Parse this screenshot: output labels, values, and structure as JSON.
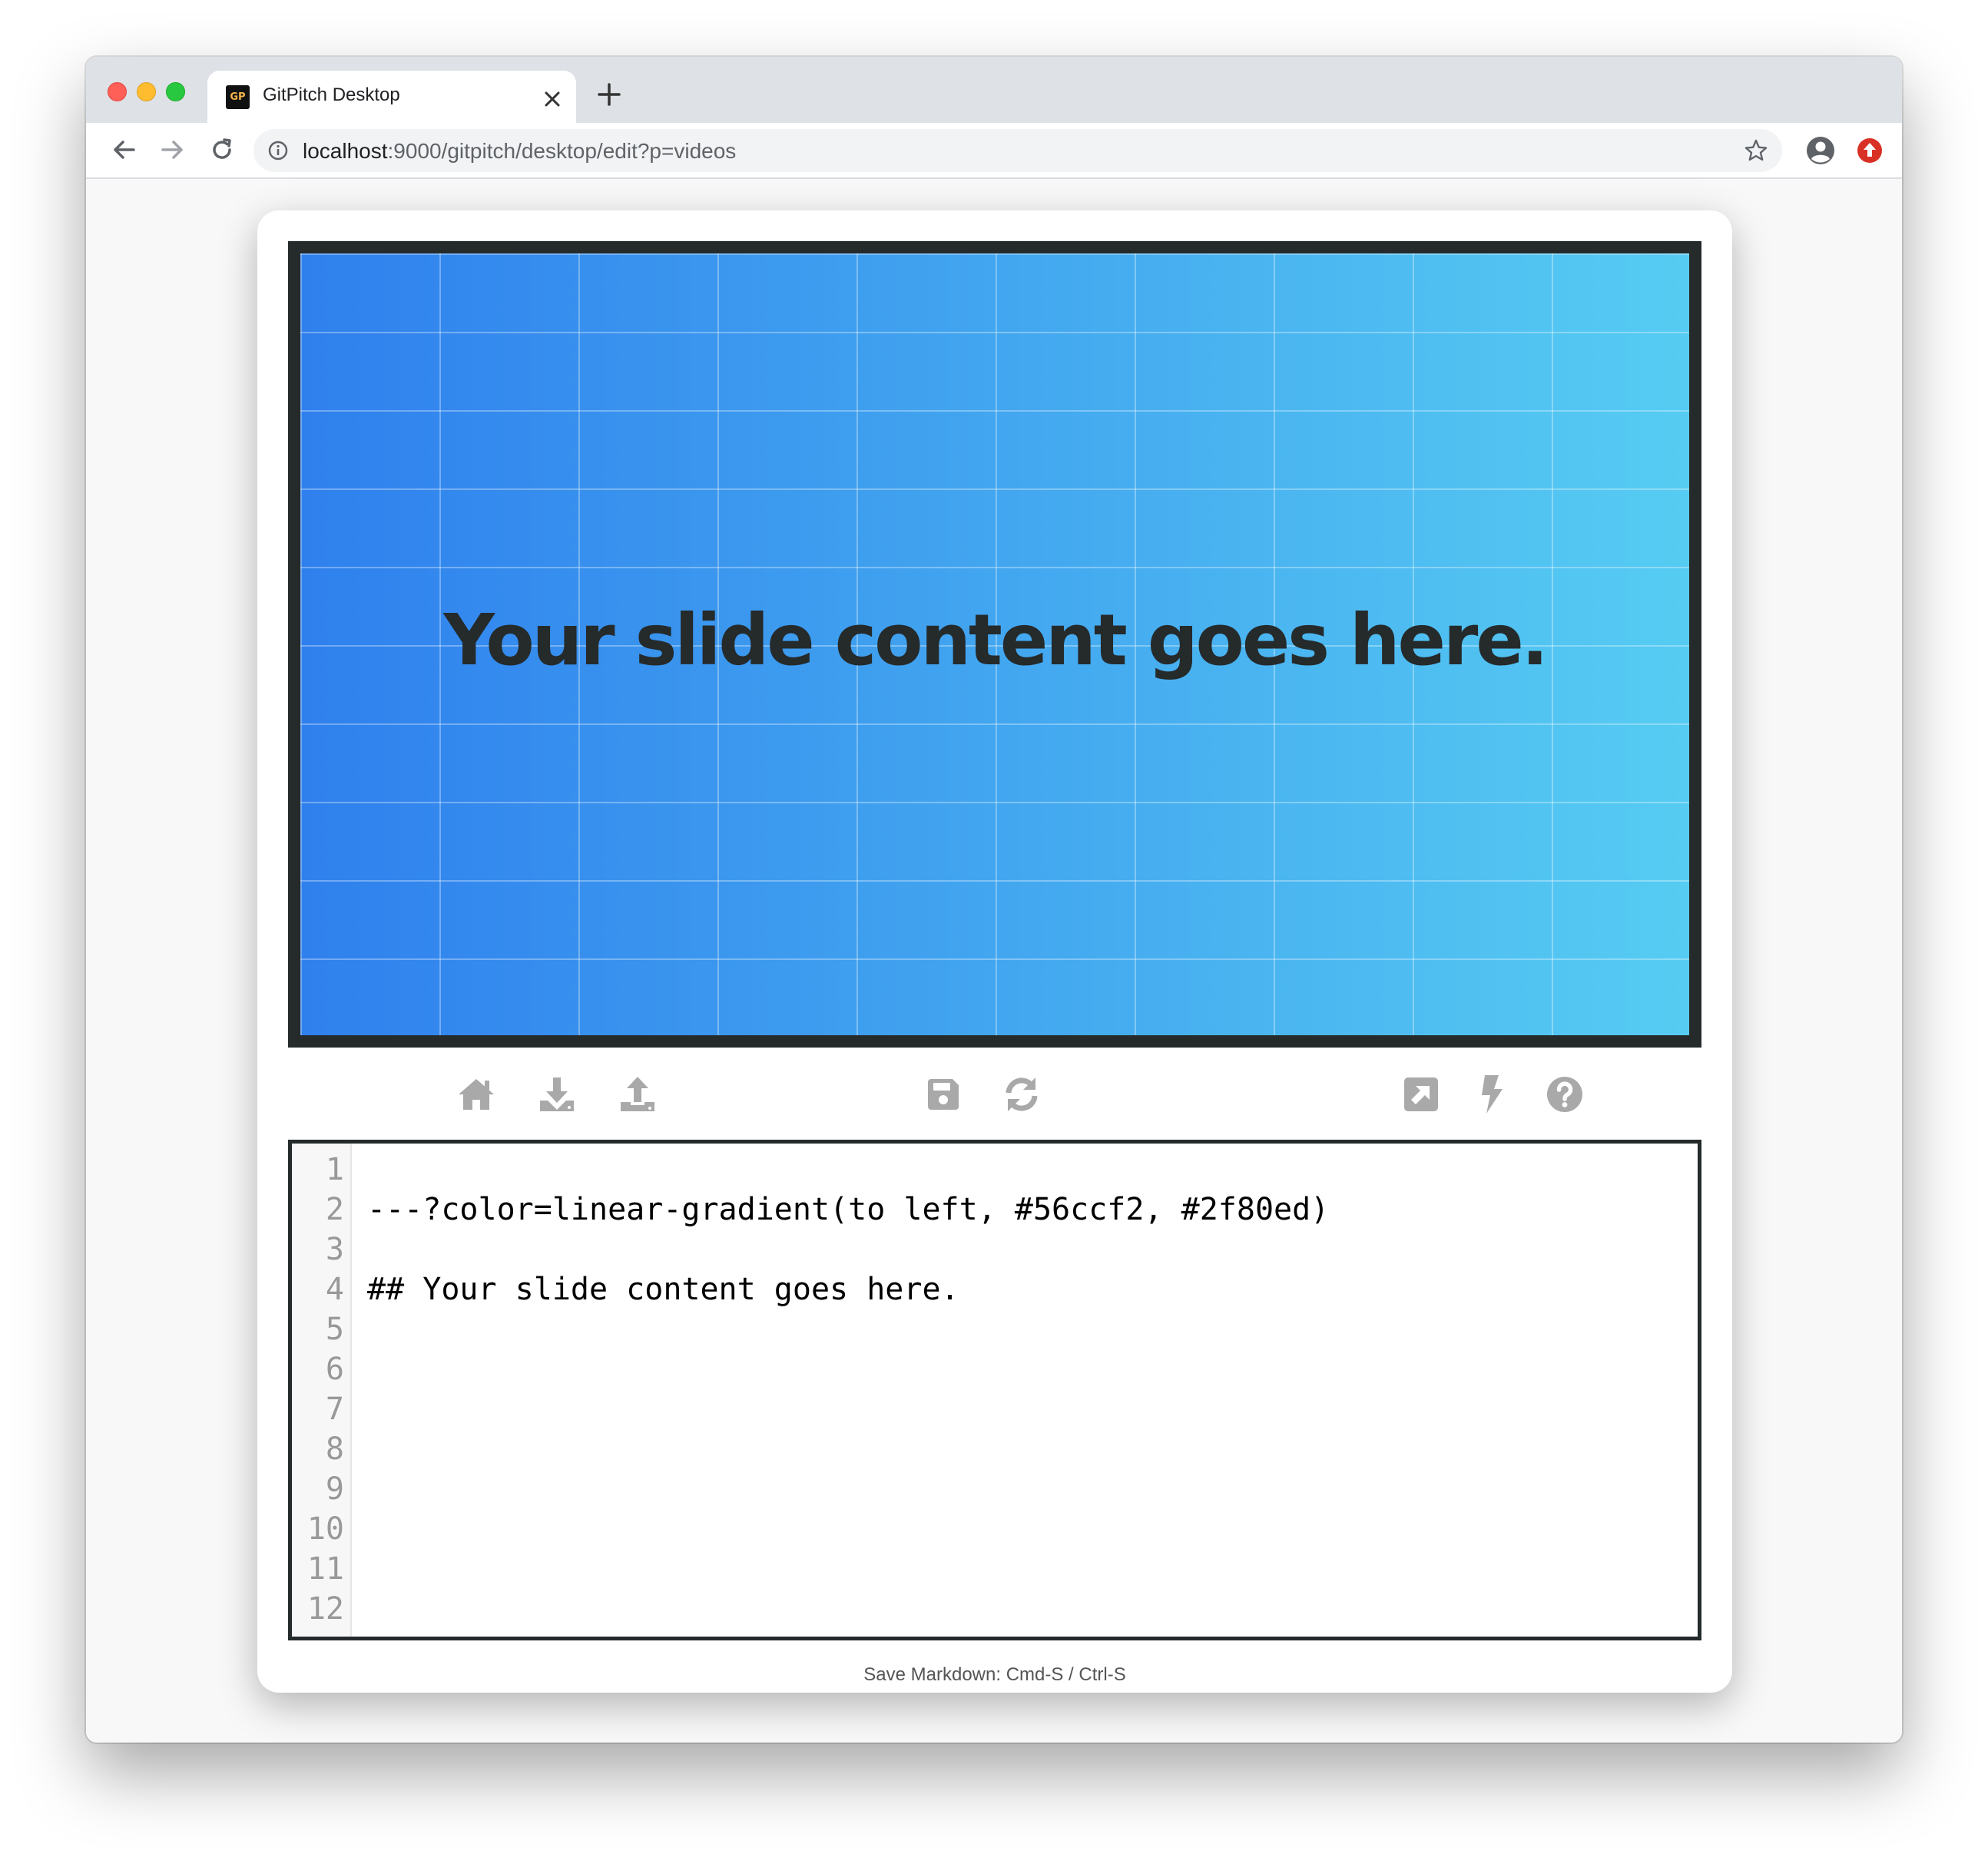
{
  "browser": {
    "tab": {
      "favicon_text": "GP",
      "title": "GitPitch Desktop"
    },
    "url": {
      "host": "localhost",
      "path": ":9000/gitpitch/desktop/edit?p=videos"
    },
    "icons": [
      "close-icon",
      "new-tab-icon",
      "back-arrow-icon",
      "forward-arrow-icon",
      "reload-icon",
      "info-icon",
      "star-icon",
      "profile-icon",
      "extension-icon"
    ]
  },
  "slide": {
    "heading": "Your slide content goes here.",
    "gradient": {
      "from": "#2f80ed",
      "to": "#56ccf2"
    },
    "text_color": "#252a2b"
  },
  "toolbar": {
    "left": [
      "home-icon",
      "download-icon",
      "upload-icon"
    ],
    "center": [
      "save-icon",
      "refresh-icon"
    ],
    "right": [
      "external-link-icon",
      "bolt-icon",
      "help-icon"
    ],
    "icon_color": "#a9a9a9"
  },
  "editor": {
    "line_numbers": [
      "1",
      "2",
      "3",
      "4",
      "5",
      "6",
      "7",
      "8",
      "9",
      "10",
      "11",
      "12"
    ],
    "lines": [
      "",
      "---?color=linear-gradient(to left, #56ccf2, #2f80ed)",
      "",
      "## Your slide content goes here.",
      "",
      "",
      "",
      "",
      "",
      "",
      "",
      ""
    ]
  },
  "footer": {
    "hint": "Save Markdown: Cmd-S / Ctrl-S"
  }
}
